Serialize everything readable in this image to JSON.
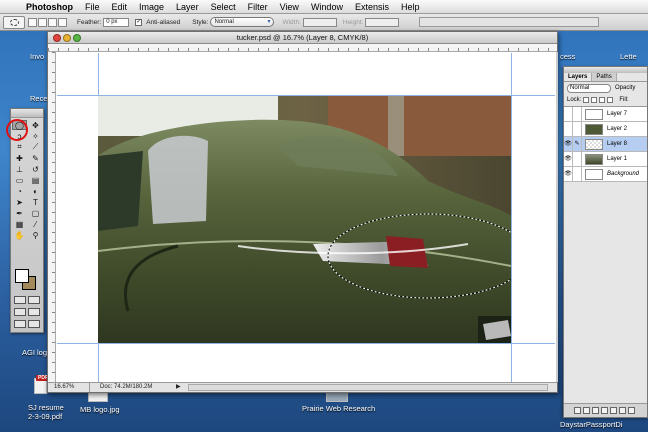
{
  "menubar": {
    "app_name": "Photoshop",
    "items": [
      "File",
      "Edit",
      "Image",
      "Layer",
      "Select",
      "Filter",
      "View",
      "Window",
      "Extensis",
      "Help"
    ]
  },
  "options_bar": {
    "feather_label": "Feather:",
    "feather_value": "0 px",
    "antialiased_label": "Anti-aliased",
    "style_label": "Style:",
    "style_value": "Normal",
    "width_label": "Width:",
    "height_label": "Height:"
  },
  "desktop": {
    "labels": {
      "invo": "Invo",
      "rece": "Rece",
      "agi_logo": "AGI log",
      "sj_resume_1": "SJ resume",
      "sj_resume_2": "2-3-09.pdf",
      "mb_logo": "MB logo.jpg",
      "prairie": "Prairie Web Research",
      "cess": "cess",
      "lette": "Lette",
      "daystar": "DaystarPassportDi"
    }
  },
  "document": {
    "title": "tucker.psd @ 16.7% (Layer 8, CMYK/8)",
    "zoom": "16.67%",
    "doc_size": "Doc: 74.2M/180.2M"
  },
  "layers_panel": {
    "tabs": [
      "Layers",
      "Paths"
    ],
    "blend_mode": "Normal",
    "opacity_label": "Opacity",
    "lock_label": "Lock:",
    "fill_label": "Fill:",
    "layers": [
      {
        "name": "Layer 7",
        "visible": false,
        "selected": false
      },
      {
        "name": "Layer 2",
        "visible": false,
        "selected": false
      },
      {
        "name": "Layer 8",
        "visible": true,
        "selected": true
      },
      {
        "name": "Layer 1",
        "visible": true,
        "selected": false
      },
      {
        "name": "Background",
        "visible": true,
        "selected": false
      }
    ]
  },
  "colors": {
    "car_green": "#4d5a35",
    "highlight_circle": "#e01010",
    "selected_layer": "#b5cdf0"
  }
}
